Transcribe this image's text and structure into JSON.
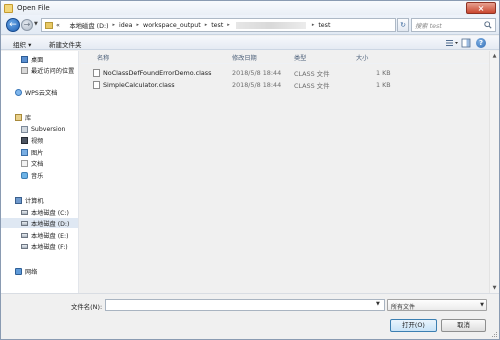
{
  "window": {
    "title": "Open File",
    "close_glyph": "×"
  },
  "address_bar": {
    "back_glyph": "←",
    "forward_glyph": "→",
    "overflow": "«",
    "path": [
      "本地磁盘 (D:)",
      "idea",
      "workspace_output",
      "test",
      "test"
    ],
    "search_placeholder": "搜索 test"
  },
  "toolbar": {
    "organize_label": "组织 ▾",
    "new_folder_label": "新建文件夹",
    "help_glyph": "?"
  },
  "nav_pane": {
    "favorites": [
      {
        "label": "桌面",
        "icon": "desktop-icon"
      },
      {
        "label": "最近访问的位置",
        "icon": "recent-places-icon"
      }
    ],
    "cloud": {
      "label": "WPS云文档",
      "icon": "cloud-icon"
    },
    "libraries": {
      "label": "库",
      "items": [
        {
          "label": "Subversion",
          "icon": "subversion-icon"
        },
        {
          "label": "视频",
          "icon": "video-icon"
        },
        {
          "label": "图片",
          "icon": "picture-icon"
        },
        {
          "label": "文档",
          "icon": "document-icon"
        },
        {
          "label": "音乐",
          "icon": "music-icon"
        }
      ]
    },
    "computer": {
      "label": "计算机",
      "drives": [
        {
          "label": "本地磁盘 (C:)"
        },
        {
          "label": "本地磁盘 (D:)",
          "selected": true
        },
        {
          "label": "本地磁盘 (E:)"
        },
        {
          "label": "本地磁盘 (F:)"
        }
      ]
    },
    "network": {
      "label": "网络"
    }
  },
  "columns": {
    "name": "名称",
    "date": "修改日期",
    "type": "类型",
    "size": "大小"
  },
  "files": [
    {
      "name": "NoClassDefFoundErrorDemo.class",
      "date": "2018/5/8 18:44",
      "type": "CLASS 文件",
      "size": "1 KB"
    },
    {
      "name": "SimpleCalculator.class",
      "date": "2018/5/8 18:44",
      "type": "CLASS 文件",
      "size": "1 KB"
    }
  ],
  "bottom": {
    "filename_label": "文件名(N):",
    "filename_value": "",
    "filetype_value": "所有文件",
    "open_label": "打开(O)",
    "cancel_label": "取消"
  },
  "colors": {
    "accent": "#3c7fb1",
    "selection": "#dfe8f3",
    "close_red": "#c9472f"
  }
}
